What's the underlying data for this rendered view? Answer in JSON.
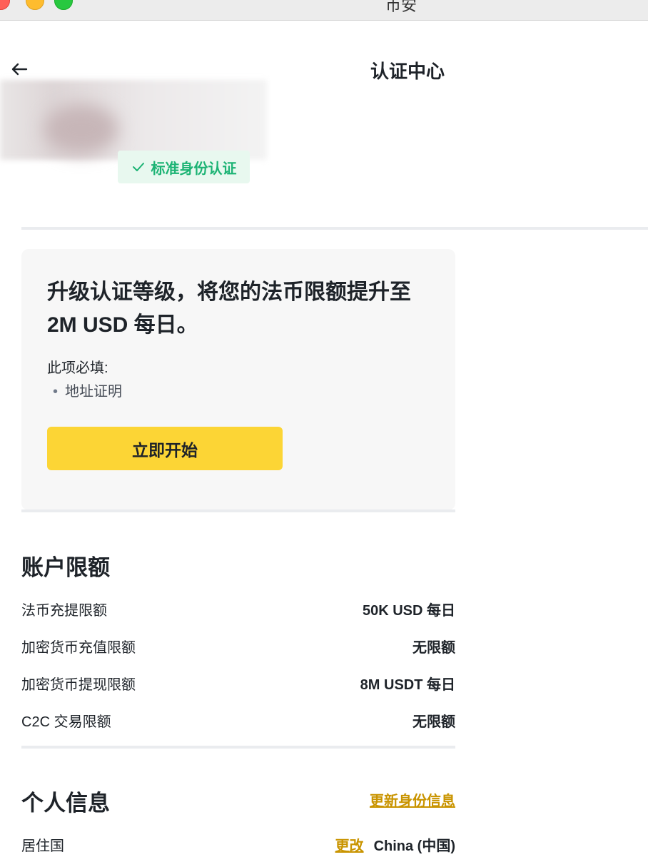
{
  "window": {
    "title": "币安"
  },
  "header": {
    "title": "认证中心",
    "back_icon": "arrow-left-icon"
  },
  "profile": {
    "badge_label": "标准身份认证",
    "badge_color": "#1cb374"
  },
  "upgrade_card": {
    "title": "升级认证等级，将您的法币限额提升至 2M USD 每日。",
    "required_label": "此项必填:",
    "required_items": [
      "地址证明"
    ],
    "start_button": "立即开始",
    "button_color": "#fcd535"
  },
  "limits": {
    "title": "账户限额",
    "rows": [
      {
        "label": "法币充提限额",
        "value": "50K USD 每日"
      },
      {
        "label": "加密货币充值限额",
        "value": "无限额"
      },
      {
        "label": "加密货币提现限额",
        "value": "8M USDT 每日"
      },
      {
        "label": "C2C 交易限额",
        "value": "无限额"
      }
    ]
  },
  "personal": {
    "title": "个人信息",
    "update_link": "更新身份信息",
    "residence_label": "居住国",
    "change_link": "更改",
    "residence_value": "China (中国)"
  },
  "colors": {
    "accent_link": "#c99400",
    "divider": "#eaecef"
  }
}
